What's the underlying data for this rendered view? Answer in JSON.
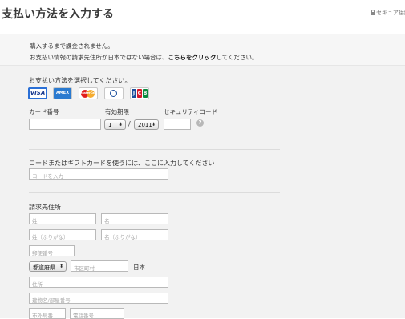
{
  "header": {
    "title": "支払い方法を入力する",
    "secure_label": "セキュア接続"
  },
  "notice": {
    "line1": "購入するまで課金されません。",
    "line2_prefix": "お支払い情報の請求先住所が日本ではない場合は、",
    "line2_link": "こちらをクリック",
    "line2_suffix": "してください。"
  },
  "payment": {
    "select_label": "お支払い方法を選択してください。",
    "cards": [
      {
        "name": "VISA",
        "icon": "visa-card-icon"
      },
      {
        "name": "AMEX",
        "icon": "amex-card-icon"
      },
      {
        "name": "MasterCard",
        "icon": "mastercard-icon"
      },
      {
        "name": "Diners",
        "icon": "diners-card-icon"
      },
      {
        "name": "JCB",
        "icon": "jcb-card-icon"
      }
    ],
    "card_number_label": "カード番号",
    "expiry_label": "有効期限",
    "security_code_label": "セキュリティコード",
    "card_number_value": "",
    "expiry_month": "1",
    "expiry_year": "2011",
    "expiry_separator": "/",
    "security_code_value": "",
    "help_glyph": "?"
  },
  "gift": {
    "label": "コードまたはギフトカードを使うには、ここに入力してください",
    "placeholder": "コードを入力"
  },
  "billing": {
    "title": "請求先住所",
    "last_name_placeholder": "姓",
    "first_name_placeholder": "名",
    "last_name_kana_placeholder": "姓（ふりがな）",
    "first_name_kana_placeholder": "名（ふりがな）",
    "postal_placeholder": "郵便番号",
    "prefecture_value": "都道府県",
    "city_placeholder": "市区町村",
    "country_label": "日本",
    "address_placeholder": "住所",
    "building_placeholder": "建物名/部屋番号",
    "area_code_placeholder": "市外局番",
    "phone_placeholder": "電話番号"
  },
  "icons": {
    "lock": "lock-icon",
    "select_arrows": "⬍"
  }
}
